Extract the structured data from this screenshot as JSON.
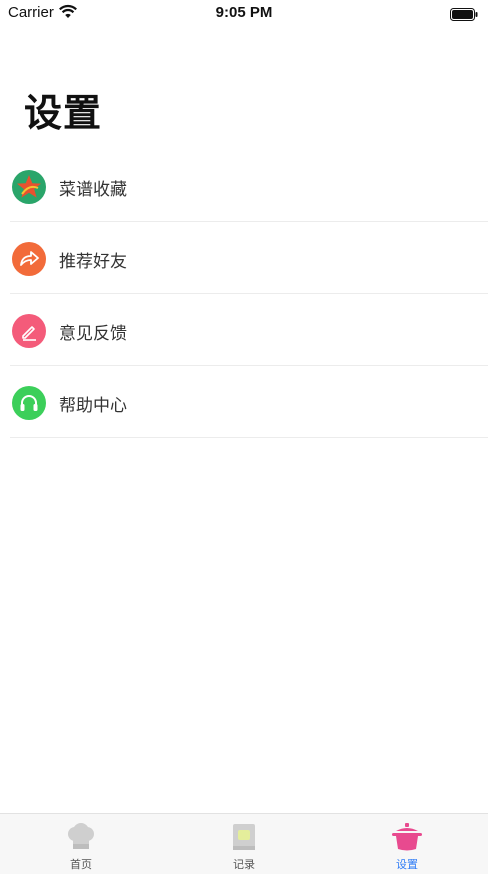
{
  "status_bar": {
    "carrier": "Carrier",
    "time": "9:05 PM"
  },
  "page": {
    "title": "设置"
  },
  "menu": [
    {
      "label": "菜谱收藏",
      "icon": "star-icon",
      "color": "#2aa56a"
    },
    {
      "label": "推荐好友",
      "icon": "share-icon",
      "color": "#f26b3a"
    },
    {
      "label": "意见反馈",
      "icon": "edit-icon",
      "color": "#f45b7a"
    },
    {
      "label": "帮助中心",
      "icon": "headphones-icon",
      "color": "#3ccf5a"
    }
  ],
  "tabs": [
    {
      "label": "首页",
      "icon": "chef-hat-icon",
      "active": false
    },
    {
      "label": "记录",
      "icon": "notebook-icon",
      "active": false
    },
    {
      "label": "设置",
      "icon": "cooking-pot-icon",
      "active": true
    }
  ],
  "colors": {
    "active_tab": "#2f7cf6",
    "pot_pink": "#e84a8f"
  }
}
